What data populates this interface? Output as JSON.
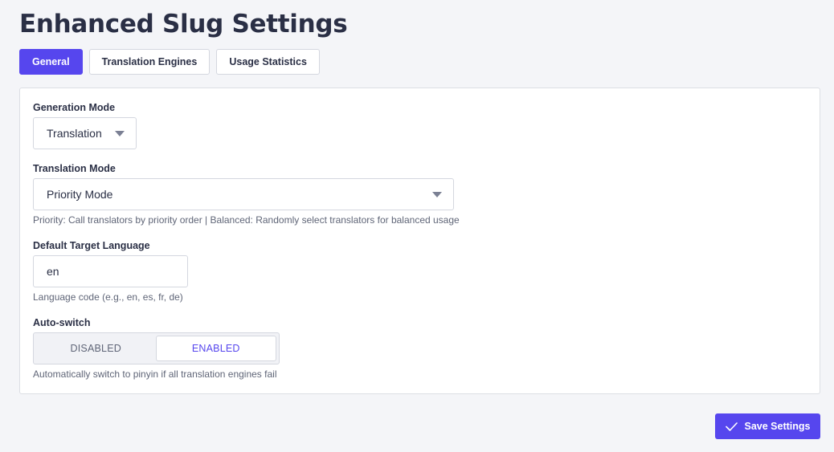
{
  "page": {
    "title": "Enhanced Slug Settings"
  },
  "tabs": [
    {
      "label": "General",
      "active": true
    },
    {
      "label": "Translation Engines",
      "active": false
    },
    {
      "label": "Usage Statistics",
      "active": false
    }
  ],
  "form": {
    "generation_mode": {
      "label": "Generation Mode",
      "value": "Translation"
    },
    "translation_mode": {
      "label": "Translation Mode",
      "value": "Priority Mode",
      "help": "Priority: Call translators by priority order | Balanced: Randomly select translators for balanced usage"
    },
    "default_target_language": {
      "label": "Default Target Language",
      "value": "en",
      "help": "Language code (e.g., en, es, fr, de)"
    },
    "auto_switch": {
      "label": "Auto-switch",
      "options": [
        "DISABLED",
        "ENABLED"
      ],
      "selected": "ENABLED",
      "help": "Automatically switch to pinyin if all translation engines fail"
    }
  },
  "actions": {
    "save_label": "Save Settings",
    "save_icon": "checkmark-icon"
  },
  "colors": {
    "accent": "#5646ee",
    "background": "#f4f5f8",
    "card": "#ffffff",
    "border": "#dcdee4"
  }
}
